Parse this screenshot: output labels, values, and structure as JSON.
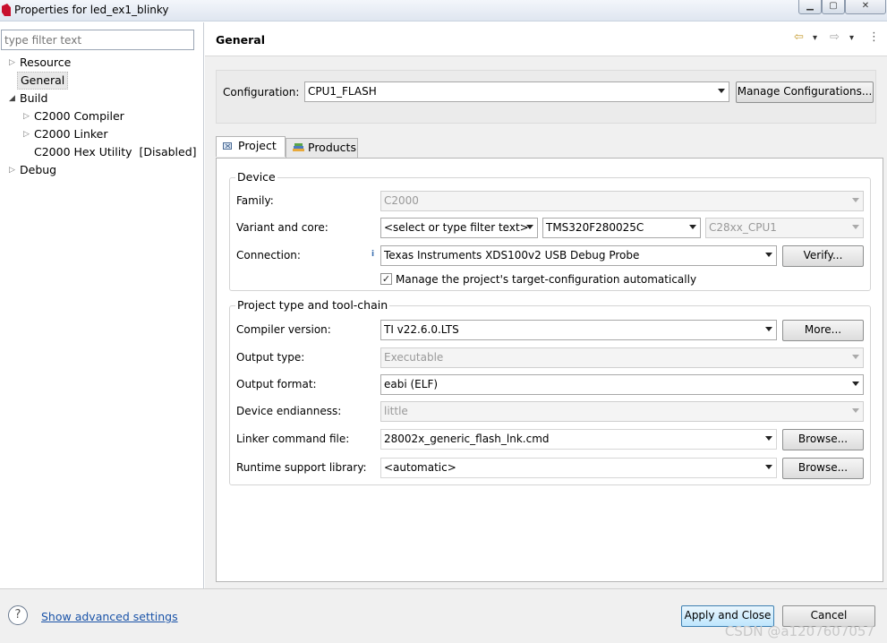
{
  "window": {
    "title": "Properties for led_ex1_blinky",
    "min_glyph": "▁",
    "max_glyph": "▢",
    "close_glyph": "✕"
  },
  "sidebar": {
    "filter_placeholder": "type filter text",
    "items": [
      {
        "label": "Resource",
        "arrow": "▷"
      },
      {
        "label": "General",
        "arrow": ""
      },
      {
        "label": "Build",
        "arrow": "◢"
      },
      {
        "label": "C2000 Compiler",
        "arrow": "▷"
      },
      {
        "label": "C2000 Linker",
        "arrow": "▷"
      },
      {
        "label": "C2000 Hex Utility  [Disabled]",
        "arrow": ""
      },
      {
        "label": "Debug",
        "arrow": "▷"
      }
    ]
  },
  "header": {
    "title": "General",
    "back_glyph": "⇦",
    "forward_glyph": "⇨",
    "menu_glyph": "▾",
    "more_glyph": "⋮"
  },
  "configuration": {
    "label": "Configuration:",
    "value": "CPU1_FLASH",
    "manage_button": "Manage Configurations..."
  },
  "tabs": [
    {
      "label": "Project"
    },
    {
      "label": "Products"
    }
  ],
  "device": {
    "group_title": "Device",
    "family_label": "Family:",
    "family_value": "C2000",
    "variant_label": "Variant and core:",
    "variant_filter": "<select or type filter text>",
    "variant_value": "TMS320F280025C",
    "core_value": "C28xx_CPU1",
    "connection_label": "Connection:",
    "connection_value": "Texas Instruments XDS100v2 USB Debug Probe",
    "verify_button": "Verify...",
    "manage_checkbox_label": "Manage the project's target-configuration automatically",
    "manage_checked": true,
    "check_glyph": "✓",
    "info_glyph": "i"
  },
  "toolchain": {
    "group_title": "Project type and tool-chain",
    "compiler_label": "Compiler version:",
    "compiler_value": "TI v22.6.0.LTS",
    "more_button": "More...",
    "output_type_label": "Output type:",
    "output_type_value": "Executable",
    "output_format_label": "Output format:",
    "output_format_value": "eabi (ELF)",
    "endianness_label": "Device endianness:",
    "endianness_value": "little",
    "linker_label": "Linker command file:",
    "linker_value": "28002x_generic_flash_lnk.cmd",
    "runtime_label": "Runtime support library:",
    "runtime_value": "<automatic>",
    "browse_button": "Browse..."
  },
  "footer": {
    "help_glyph": "?",
    "advanced_link": "Show advanced settings",
    "apply_button": "Apply and Close",
    "cancel_button": "Cancel",
    "watermark": "CSDN @a1207607057"
  }
}
